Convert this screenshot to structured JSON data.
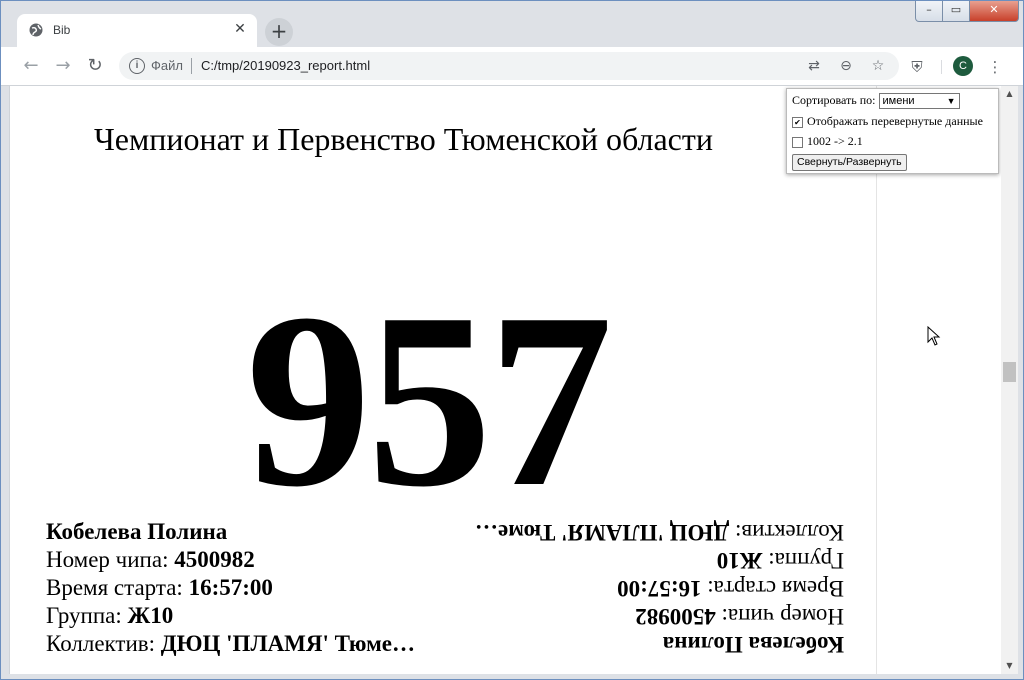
{
  "browser": {
    "tab_title": "Bib",
    "tab_close": "✕",
    "new_tab": "+",
    "scheme_label": "Файл",
    "url": "C:/tmp/20190923_report.html",
    "avatar_letter": "C",
    "window_controls": {
      "minimize": "–",
      "maximize": "▭",
      "close": "✕"
    }
  },
  "page": {
    "event_title": "Чемпионат и Первенство Тюменской области",
    "bib_number": "957",
    "participant": {
      "name": "Кобелева Полина",
      "chip_label": "Номер чипа: ",
      "chip_value": "4500982",
      "start_label": "Время старта: ",
      "start_value": "16:57:00",
      "group_label": "Группа: ",
      "group_value": "Ж10",
      "team_label": "Коллектив: ",
      "team_value": "ДЮЦ 'ПЛАМЯ' Тюме…"
    }
  },
  "controls": {
    "sort_label": "Сортировать по:",
    "sort_value": "имени",
    "show_flipped_label": "Отображать перевернутые данные",
    "show_flipped_checked": true,
    "version_label": "1002 -> 2.1",
    "version_checked": false,
    "toggle_button": "Свернуть/Развернуть"
  },
  "icons": {
    "back": "arrow-left-icon",
    "forward": "arrow-right-icon",
    "reload": "reload-icon",
    "info": "info-icon",
    "translate": "translate-icon",
    "zoom": "zoom-out-icon",
    "bookmark": "star-icon",
    "extension": "shield-extension-icon",
    "menu": "kebab-menu-icon"
  },
  "colors": {
    "avatar": "#1e5b3e",
    "window_border": "#6c8fbf",
    "close_button": "#c8402a"
  }
}
